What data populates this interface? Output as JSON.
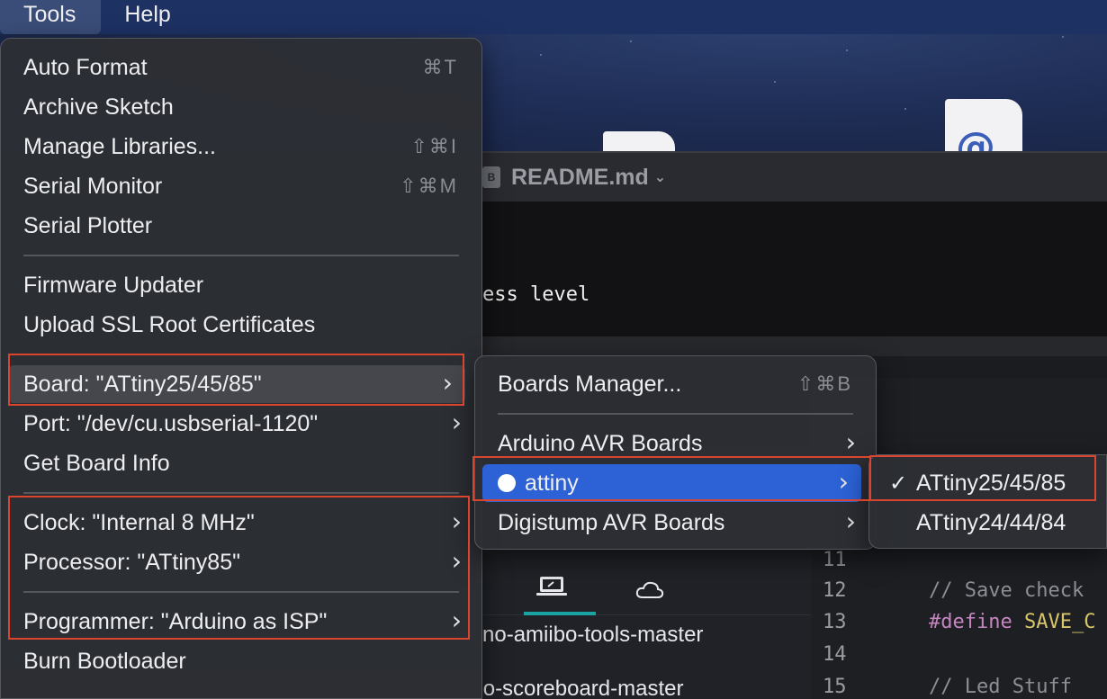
{
  "menubar": {
    "items": [
      {
        "label": "Tools",
        "active": true
      },
      {
        "label": "Help",
        "active": false
      }
    ]
  },
  "editor": {
    "tab_filename": "README.md",
    "code_fragment": "ess level",
    "file_tree": [
      "no-amiibo-tools-master",
      "arduino-scoreboard-master"
    ],
    "line_numbers": [
      "11",
      "12",
      "13",
      "14",
      "15"
    ],
    "code": {
      "line12": "// Save check",
      "line13_kw": "#define",
      "line13_rest": "SAVE_C",
      "line15": "// Led Stuff"
    }
  },
  "tools_menu": {
    "auto_format": {
      "label": "Auto Format",
      "shortcut": "⌘T"
    },
    "archive_sketch": {
      "label": "Archive Sketch"
    },
    "manage_libraries": {
      "label": "Manage Libraries...",
      "shortcut": "⇧⌘I"
    },
    "serial_monitor": {
      "label": "Serial Monitor",
      "shortcut": "⇧⌘M"
    },
    "serial_plotter": {
      "label": "Serial Plotter"
    },
    "firmware_updater": {
      "label": "Firmware Updater"
    },
    "upload_ssl": {
      "label": "Upload SSL Root Certificates"
    },
    "board": {
      "label": "Board: \"ATtiny25/45/85\""
    },
    "port": {
      "label": "Port: \"/dev/cu.usbserial-1120\""
    },
    "get_board_info": {
      "label": "Get Board Info"
    },
    "clock": {
      "label": "Clock: \"Internal 8 MHz\""
    },
    "processor": {
      "label": "Processor: \"ATtiny85\""
    },
    "programmer": {
      "label": "Programmer: \"Arduino as ISP\""
    },
    "burn_bootloader": {
      "label": "Burn Bootloader"
    }
  },
  "board_menu": {
    "boards_manager": {
      "label": "Boards Manager...",
      "shortcut": "⇧⌘B"
    },
    "arduino_avr": {
      "label": "Arduino AVR Boards"
    },
    "attiny": {
      "label": "attiny"
    },
    "digistump": {
      "label": "Digistump AVR Boards"
    }
  },
  "attiny_menu": {
    "items": [
      {
        "label": "ATtiny25/45/85",
        "checked": true,
        "check": "✓"
      },
      {
        "label": "ATtiny24/44/84",
        "checked": false,
        "check": ""
      }
    ]
  },
  "colors": {
    "selection": "#2c62d6",
    "highlight_box": "#d9452e",
    "menubar": "#1d3163"
  }
}
